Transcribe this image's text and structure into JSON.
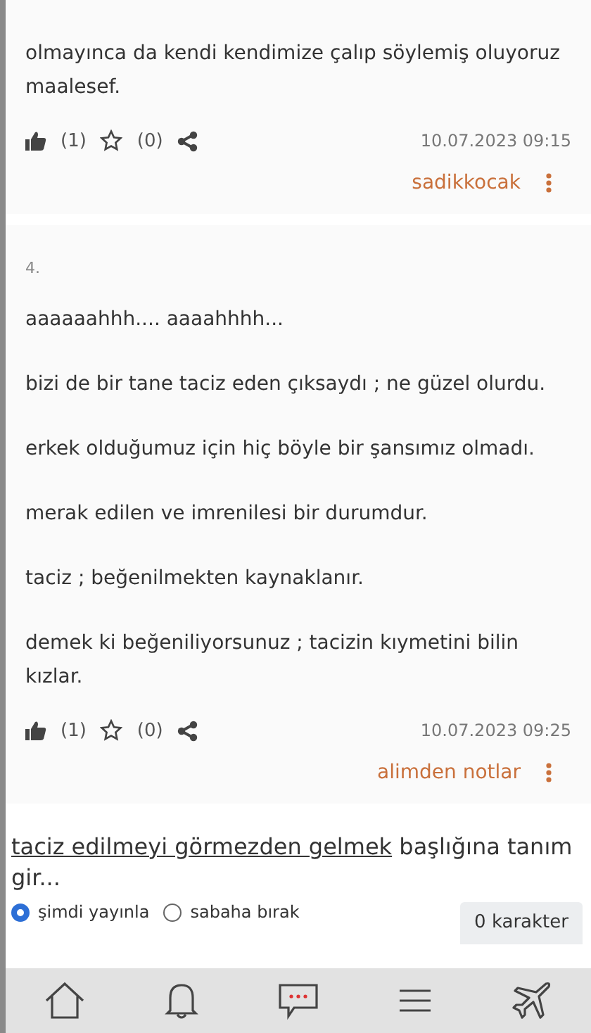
{
  "entries": [
    {
      "paragraphs": [
        "olmayınca da kendi kendimize çalıp söylemiş oluyoruz maalesef."
      ],
      "likes": "(1)",
      "favorites": "(0)",
      "date": "10.07.2023 09:15",
      "author": "sadikkocak"
    },
    {
      "number": "4.",
      "paragraphs": [
        "aaaaaahhh.... aaaahhhh...",
        "bizi de bir tane taciz eden çıksaydı ; ne güzel olurdu.",
        "erkek olduğumuz için hiç böyle bir şansımız olmadı.",
        "merak edilen ve imrenilesi bir durumdur.",
        "taciz ; beğenilmekten kaynaklanır.",
        "demek ki beğeniliyorsunuz ; tacizin kıymetini bilin kızlar."
      ],
      "likes": "(1)",
      "favorites": "(0)",
      "date": "10.07.2023 09:25",
      "author": "alimden notlar"
    }
  ],
  "compose": {
    "topic_link": "taciz edilmeyi görmezden gelmek",
    "prompt": "başlığına tanım gir...",
    "options": [
      {
        "label": "şimdi yayınla",
        "selected": true
      },
      {
        "label": "sabaha bırak",
        "selected": false
      }
    ],
    "char_count": "0 karakter"
  },
  "nav": [
    {
      "kind": "home"
    },
    {
      "kind": "bell"
    },
    {
      "kind": "chat"
    },
    {
      "kind": "menu"
    },
    {
      "kind": "plane"
    }
  ]
}
